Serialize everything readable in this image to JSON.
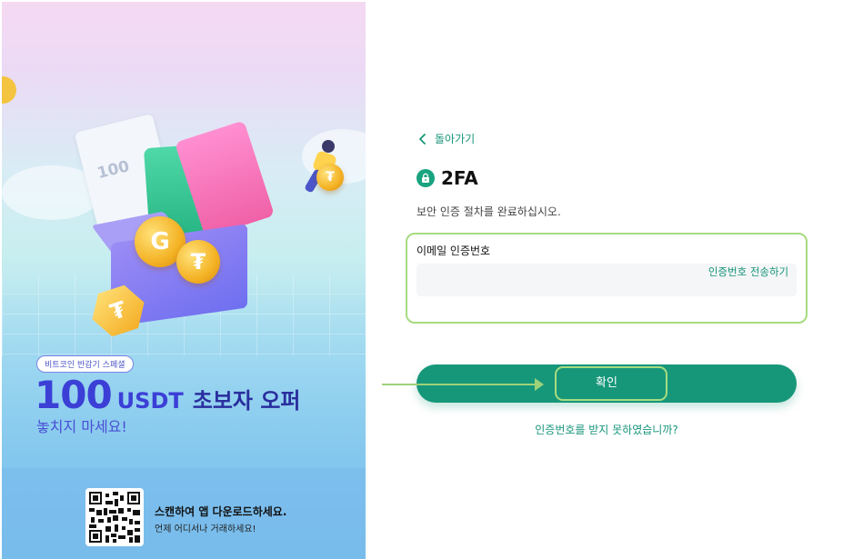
{
  "promo": {
    "badge": "비트코인 반감기 스페셜",
    "headline_amount": "100",
    "headline_unit": "USDT",
    "headline_text": "초보자 오퍼",
    "subline": "놓치지 마세요!",
    "receipt_text": "100",
    "coin_letter": "G",
    "qr_title": "스캔하여 앱 다운로드하세요.",
    "qr_subtitle": "언제 어디서나 거래하세요!"
  },
  "form": {
    "back_label": "돌아가기",
    "title": "2FA",
    "description": "보안 인증 절차를 완료하십시오.",
    "email_field_label": "이메일 인증번호",
    "email_field_value": "",
    "send_code_label": "인증번호 전송하기",
    "confirm_label": "확인",
    "no_code_link": "인증번호를 받지 못하였습니까?"
  },
  "colors": {
    "accent": "#17977a",
    "highlight": "#a6dc80",
    "promo_brand": "#3b3fd6"
  },
  "icons": {
    "back": "chevron-left-icon",
    "title": "lock-icon"
  }
}
